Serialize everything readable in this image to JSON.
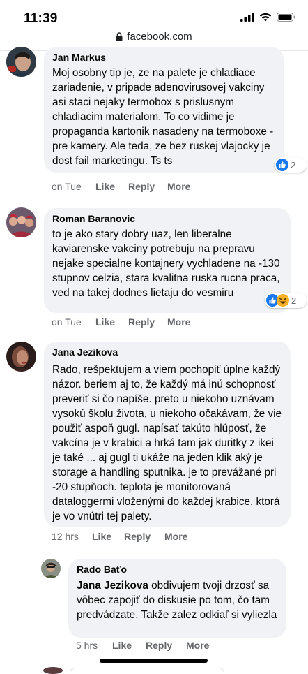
{
  "status": {
    "time": "11:39"
  },
  "browser": {
    "url": "facebook.com"
  },
  "comments": [
    {
      "author": "Jan Markus",
      "text": "Moj osobny tip je, ze na palete je chladiace zariadenie, v pripade adenovirusovej vakciny asi staci nejaky termobox s prislusnym chladiacim materialom. To co vidime je propaganda kartonik nasadeny na termoboxe - pre kamery. Ale teda, ze bez ruskej vlajocky je dost fail marketingu. Ts ts",
      "time": "on Tue",
      "like": "Like",
      "reply": "Reply",
      "more": "More",
      "reaction_count": "2",
      "reactions": [
        "like"
      ]
    },
    {
      "author": "Roman Baranovic",
      "text": "to je ako stary dobry uaz, len liberalne kaviarenske vakciny potrebuju na prepravu nejake specialne kontajnery vychladene na -130 stupnov celzia, stara kvalitna ruska rucna praca, ved na takej dodnes lietaju do vesmiru",
      "time": "on Tue",
      "like": "Like",
      "reply": "Reply",
      "more": "More",
      "reaction_count": "2",
      "reactions": [
        "like",
        "haha"
      ]
    },
    {
      "author": "Jana Jezikova",
      "text": "Rado, rešpektujem a viem pochopiť úplne každý názor. beriem aj to, že každý má inú schopnosť preveriť si čo napíše. preto u niekoho uznávam vysokú školu života, u niekoho očakávam, že vie použiť aspoň gugl. napísať takúto hlúposť, že vakcína je v krabici a hrká tam jak duritky z ikei je také ... aj gugl ti ukáže na jeden klik aký je storage a handling sputnika. je to prevážané pri -20 stupňoch. teplota je monitorovaná dataloggermi vloženými do každej krabice, ktorá je vo vnútri tej palety.",
      "time": "12 hrs",
      "like": "Like",
      "reply": "Reply",
      "more": "More"
    },
    {
      "author": "Rado Baťo",
      "mention": "Jana Jezikova",
      "text": " obdivujem tvoji drzosť sa vôbec zapojiť do diskusie po tom, čo tam predvádzate. Takže zalez odkiaľ si vyliezla",
      "time": "5 hrs",
      "like": "Like",
      "reply": "Reply",
      "more": "More"
    }
  ],
  "colors": {
    "bubble": "#f0f2f5",
    "meta": "#65676b",
    "like_blue": "#1877f2"
  }
}
